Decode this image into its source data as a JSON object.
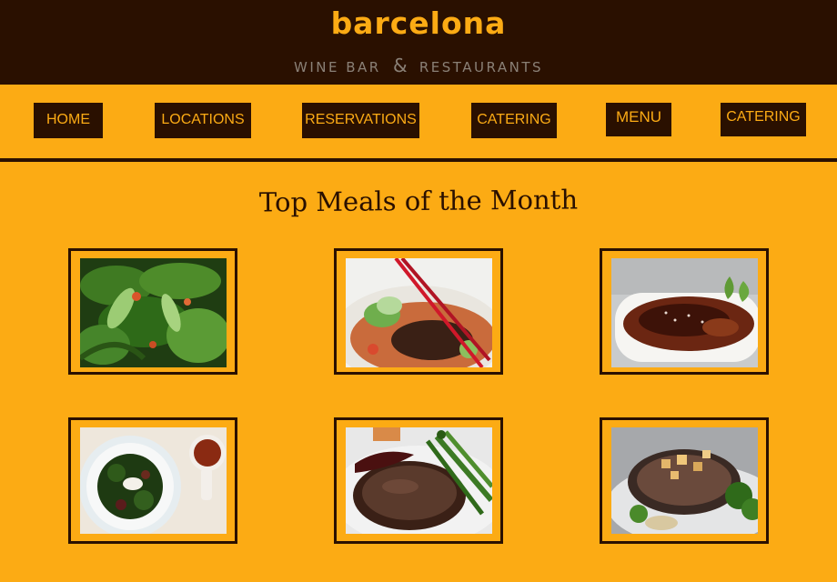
{
  "brand": {
    "name": "barcelona",
    "tagline_left": "WINE BAR",
    "tagline_amp": "&",
    "tagline_right": "RESTAURANTS"
  },
  "nav": {
    "items": [
      {
        "label": "HOME"
      },
      {
        "label": "LOCATIONS"
      },
      {
        "label": "RESERVATIONS"
      },
      {
        "label": "CATERING"
      },
      {
        "label": "MENU"
      },
      {
        "label": "CATERING"
      }
    ]
  },
  "main": {
    "title": "Top Meals of the Month"
  },
  "colors": {
    "background": "#fcab14",
    "dark": "#2a1000"
  },
  "meals": [
    {
      "image": "green-salad-photo"
    },
    {
      "image": "ramen-bowl-photo"
    },
    {
      "image": "creme-brulee-photo"
    },
    {
      "image": "spinach-plate-photo"
    },
    {
      "image": "steak-asparagus-photo"
    },
    {
      "image": "pork-chop-photo"
    }
  ]
}
